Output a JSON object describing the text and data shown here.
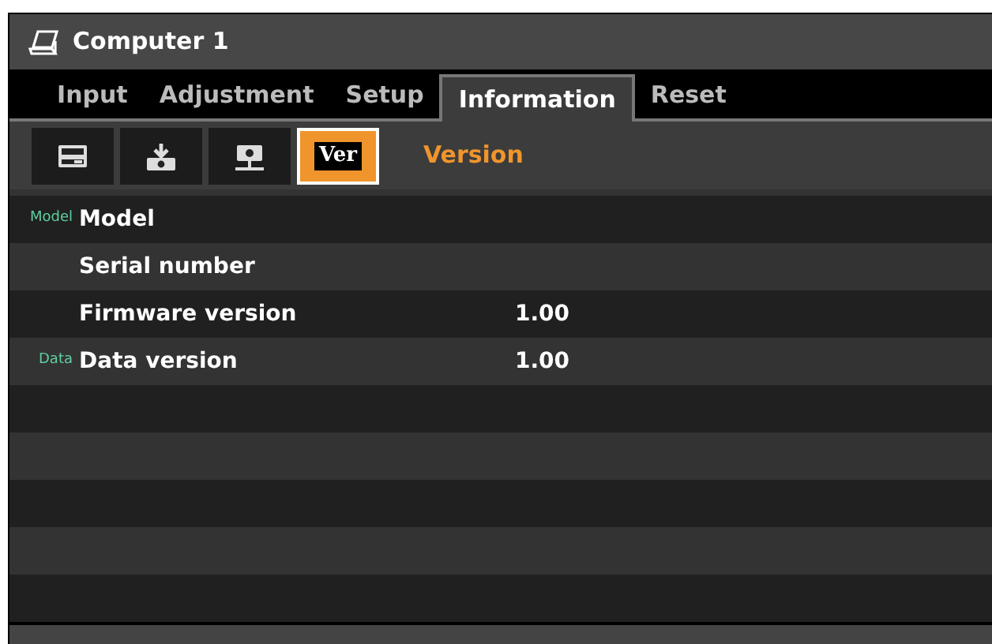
{
  "window": {
    "title": "Computer 1"
  },
  "tabs": [
    {
      "label": "Input",
      "selected": false
    },
    {
      "label": "Adjustment",
      "selected": false
    },
    {
      "label": "Setup",
      "selected": false
    },
    {
      "label": "Information",
      "selected": true
    },
    {
      "label": "Reset",
      "selected": false
    }
  ],
  "subtabs": [
    {
      "kind": "timer",
      "selected": false
    },
    {
      "kind": "download",
      "selected": false
    },
    {
      "kind": "projector",
      "selected": false
    },
    {
      "kind": "text",
      "label": "Ver",
      "selected": true
    }
  ],
  "section_title": "Version",
  "rows": [
    {
      "tag": "Model",
      "label": "Model"
    },
    {
      "label": "Serial number"
    },
    {
      "label": "Firmware version",
      "value": "1.00"
    },
    {
      "tag": "Data",
      "label": "Data version",
      "value": "1.00"
    }
  ]
}
